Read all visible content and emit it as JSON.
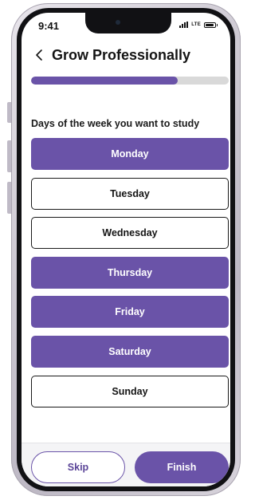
{
  "status_bar": {
    "time": "9:41",
    "network_label": "LTE",
    "icons": [
      "signal-bars-icon",
      "battery-icon"
    ]
  },
  "header": {
    "back_icon": "chevron-left-icon",
    "title": "Grow Professionally"
  },
  "progress": {
    "fraction": 0.74,
    "fill_color": "#6a53a8",
    "track_color": "#d9d9d9"
  },
  "question": "Days of the week you want to study",
  "days": [
    {
      "label": "Monday",
      "selected": true
    },
    {
      "label": "Tuesday",
      "selected": false
    },
    {
      "label": "Wednesday",
      "selected": false
    },
    {
      "label": "Thursday",
      "selected": true
    },
    {
      "label": "Friday",
      "selected": true
    },
    {
      "label": "Saturday",
      "selected": true
    },
    {
      "label": "Sunday",
      "selected": false
    }
  ],
  "footer": {
    "skip_label": "Skip",
    "finish_label": "Finish"
  },
  "colors": {
    "accent": "#6a53a8",
    "text": "#141414",
    "background": "#ffffff"
  }
}
